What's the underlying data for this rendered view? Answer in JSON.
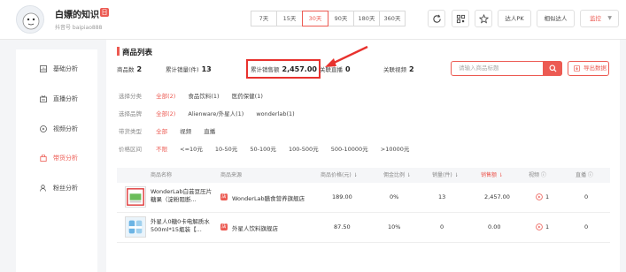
{
  "account": {
    "name": "白嫖的知识",
    "badge": "日",
    "id_text": "抖音号 baipiao888"
  },
  "day_tabs": [
    "7天",
    "15天",
    "30天",
    "90天",
    "180天",
    "360天"
  ],
  "active_day_tab": "30天",
  "header_buttons": {
    "pk": "达人PK",
    "similar": "相似达人",
    "dropdown": "监控"
  },
  "sidebar": {
    "items": [
      {
        "label": "基础分析",
        "icon": "chart-icon"
      },
      {
        "label": "直播分析",
        "icon": "live-icon"
      },
      {
        "label": "视频分析",
        "icon": "video-icon"
      },
      {
        "label": "带货分析",
        "icon": "bag-icon"
      },
      {
        "label": "粉丝分析",
        "icon": "fans-icon"
      }
    ],
    "active": "带货分析"
  },
  "main": {
    "title": "商品列表",
    "stats": [
      {
        "label": "商品数",
        "value": "2"
      },
      {
        "label": "累计销量(件)",
        "value": "13"
      },
      {
        "label": "累计销售额",
        "value": "2,457.00"
      },
      {
        "label": "关联直播",
        "value": "0"
      },
      {
        "label": "关联视频",
        "value": "2"
      }
    ],
    "search_placeholder": "请输入商品标题",
    "export_label": "导出数据",
    "filters": [
      {
        "label": "选择分类",
        "options": [
          "全部(2)",
          "食品饮料(1)",
          "医药保健(1)"
        ],
        "active": 0
      },
      {
        "label": "选择品牌",
        "options": [
          "全部(2)",
          "Alienware/外星人(1)",
          "wonderlab(1)"
        ],
        "active": 0
      },
      {
        "label": "带货类型",
        "options": [
          "全部",
          "视频",
          "直播"
        ],
        "active": 0
      },
      {
        "label": "价格区间",
        "options": [
          "不限",
          "<=10元",
          "10-50元",
          "50-100元",
          "100-500元",
          "500-10000元",
          ">10000元"
        ],
        "active": 0
      }
    ],
    "table": {
      "headers": {
        "name": "商品名称",
        "source": "商品来源",
        "price": "商品价格(元) ⇂",
        "commission": "佣金比例 ⇂",
        "sales": "销量(件) ⇂",
        "revenue": "销售额 ⇂",
        "video": "视频 ⓘ",
        "live": "直播 ⓘ"
      },
      "rows": [
        {
          "name": "WonderLab白芸豆压片糖果（淀粉阻断...",
          "source": "WonderLab膳食营养旗舰店",
          "price": "189.00",
          "commission": "0%",
          "sales": "13",
          "revenue": "2,457.00",
          "video": "1",
          "live": "0"
        },
        {
          "name": "外星人0糖0卡电解质水500ml*15瓶装【...",
          "source": "外星人饮料旗舰店",
          "price": "87.50",
          "commission": "10%",
          "sales": "0",
          "revenue": "0.00",
          "video": "1",
          "live": "0"
        }
      ]
    }
  },
  "colors": {
    "accent": "#ec5a52",
    "highlight": "#e8322e"
  }
}
